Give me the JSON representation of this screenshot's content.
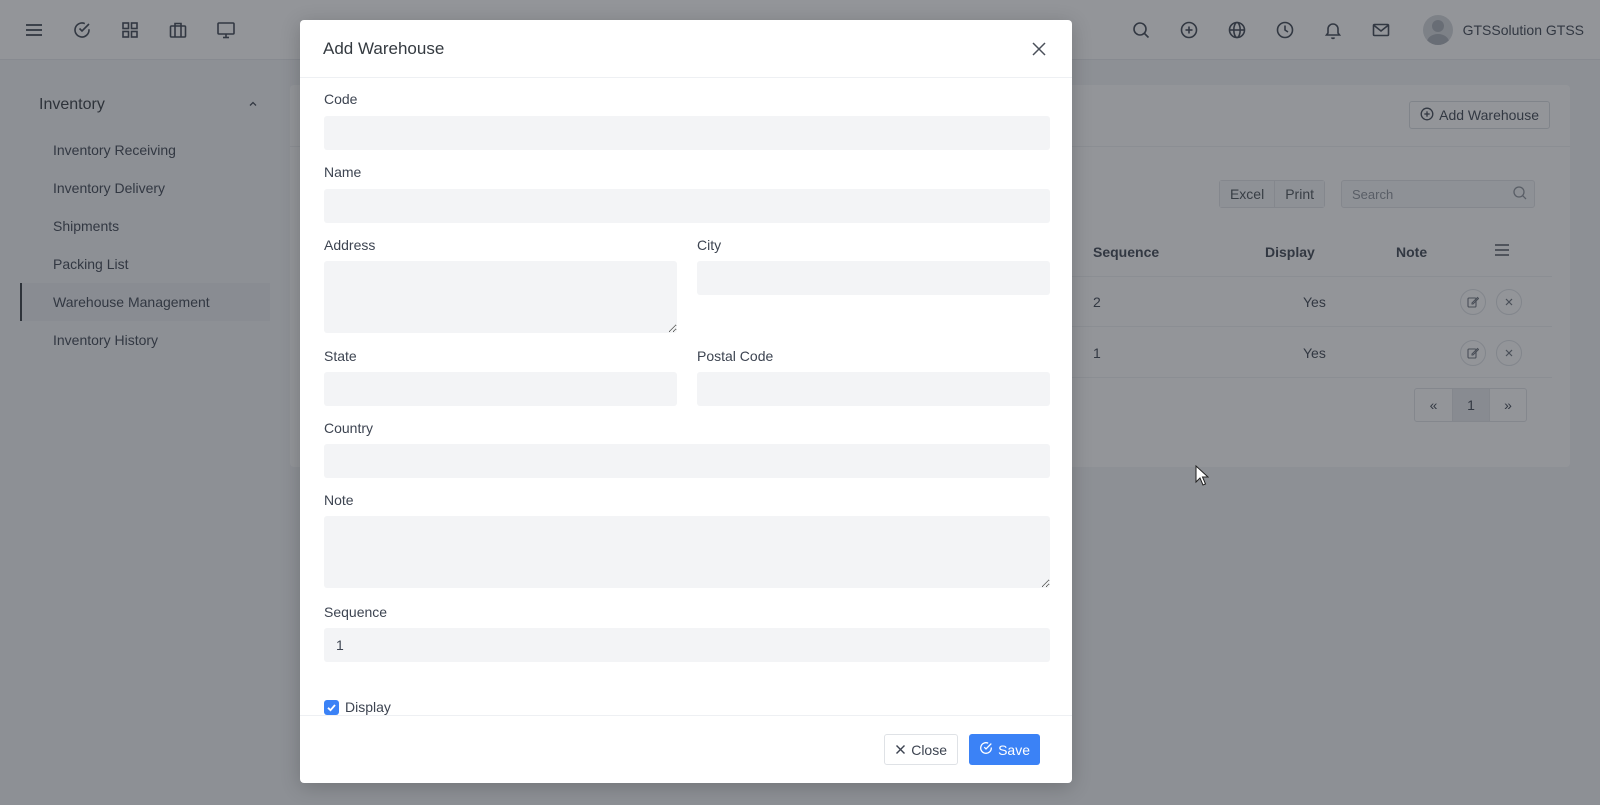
{
  "topbar": {
    "left_icons": [
      "menu-icon",
      "check-circle-icon",
      "grid-icon",
      "briefcase-icon",
      "monitor-icon"
    ],
    "right_icons": [
      "search-icon",
      "plus-circle-icon",
      "globe-icon",
      "clock-icon",
      "bell-icon",
      "mail-icon"
    ],
    "user_name": "GTSSolution GTSS"
  },
  "sidebar": {
    "section_title": "Inventory",
    "items": [
      {
        "label": "Inventory Receiving",
        "active": false
      },
      {
        "label": "Inventory Delivery",
        "active": false
      },
      {
        "label": "Shipments",
        "active": false
      },
      {
        "label": "Packing List",
        "active": false
      },
      {
        "label": "Warehouse Management",
        "active": true
      },
      {
        "label": "Inventory History",
        "active": false
      }
    ]
  },
  "main": {
    "add_button_label": "Add Warehouse",
    "export_buttons": [
      "Excel",
      "Print"
    ],
    "search_placeholder": "Search",
    "table": {
      "headers": {
        "sequence": "Sequence",
        "display": "Display",
        "note": "Note"
      },
      "rows": [
        {
          "sequence": "2",
          "display": "Yes",
          "note": ""
        },
        {
          "sequence": "1",
          "display": "Yes",
          "note": ""
        }
      ]
    },
    "pagination": {
      "prev": "«",
      "current": "1",
      "next": "»"
    }
  },
  "modal": {
    "title": "Add Warehouse",
    "fields": {
      "code_label": "Code",
      "code_value": "",
      "name_label": "Name",
      "name_value": "",
      "address_label": "Address",
      "city_label": "City",
      "state_label": "State",
      "postal_code_label": "Postal Code",
      "country_label": "Country",
      "note_label": "Note",
      "sequence_label": "Sequence",
      "sequence_value": "1",
      "display_label": "Display",
      "display_checked": true
    },
    "close_label": "Close",
    "save_label": "Save"
  },
  "colors": {
    "primary": "#3b82f6",
    "overlay": "rgba(40,44,52,0.5)",
    "input_bg": "#f3f4f6"
  }
}
